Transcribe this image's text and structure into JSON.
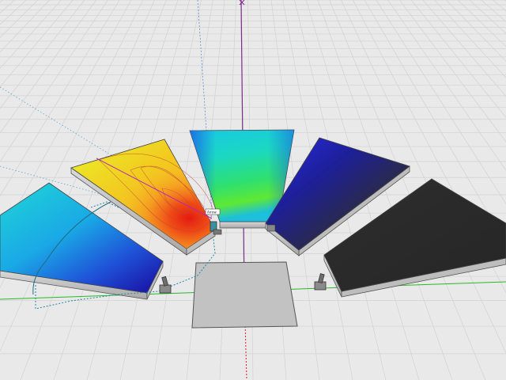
{
  "scene": {
    "panels": [
      {
        "id": "panel-left",
        "colormap_range": "cyan-to-blue"
      },
      {
        "id": "panel-heatmap",
        "colormap_range": "yellow-to-red-hotspot"
      },
      {
        "id": "panel-center",
        "colormap_range": "cyan-to-green"
      },
      {
        "id": "panel-right",
        "colormap_range": "blue-to-black"
      },
      {
        "id": "panel-far-right",
        "colormap_range": "black"
      }
    ],
    "floor_plate": {
      "color": "#c2c2c2"
    },
    "tiny_label": "Arrow",
    "colors": {
      "background": "#e9e9e9",
      "grid": "#d4d4d4",
      "axis_red": "#d11f2a",
      "axis_green": "#29b829",
      "axis_blue": "#2a2ae0",
      "panel_edge": "#555555"
    }
  }
}
